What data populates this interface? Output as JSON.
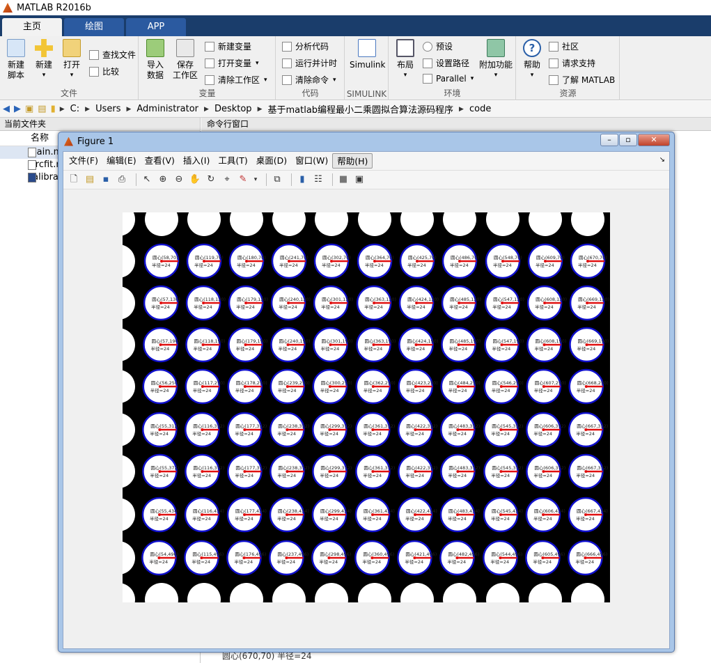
{
  "app": {
    "title": "MATLAB R2016b"
  },
  "tabs": [
    {
      "label": "主页"
    },
    {
      "label": "绘图"
    },
    {
      "label": "APP"
    }
  ],
  "ribbon": {
    "file": {
      "title": "文件",
      "new_script": "新建\n脚本",
      "new": "新建",
      "open": "打开",
      "find_files": "查找文件",
      "compare": "比较"
    },
    "variable": {
      "title": "变量",
      "import": "导入\n数据",
      "save_ws": "保存\n工作区",
      "new_var": "新建变量",
      "open_var": "打开变量",
      "clear_ws": "清除工作区"
    },
    "code": {
      "title": "代码",
      "analyze": "分析代码",
      "run_time": "运行并计时",
      "clear_cmd": "清除命令"
    },
    "simulink": {
      "title": "SIMULINK",
      "simulink": "Simulink"
    },
    "env": {
      "title": "环境",
      "layout": "布局",
      "prefs": "预设",
      "set_path": "设置路径",
      "parallel": "Parallel",
      "addons": "附加功能"
    },
    "res": {
      "title": "资源",
      "help": "帮助",
      "community": "社区",
      "support": "请求支持",
      "learn": "了解 MATLAB"
    }
  },
  "address": {
    "crumbs": [
      "C:",
      "Users",
      "Administrator",
      "Desktop",
      "基于matlab编程最小二乘圆拟合算法源码程序",
      "code"
    ]
  },
  "current_folder": {
    "header": "当前文件夹",
    "name_col": "名称",
    "files": [
      {
        "name": "main.m"
      },
      {
        "name": "circfit.m"
      },
      {
        "name": "calibrat"
      }
    ]
  },
  "command_window": {
    "header": "命令行窗口",
    "last_line": "圆心(670,70) 半径=24"
  },
  "figure": {
    "title": "Figure 1",
    "menus": [
      "文件(F)",
      "编辑(E)",
      "查看(V)",
      "插入(I)",
      "工具(T)",
      "桌面(D)",
      "窗口(W)",
      "帮助(H)"
    ],
    "circle_radius_label": "半径=24",
    "center_prefix": "圆心",
    "col_x": [
      58,
      119,
      180,
      241,
      302,
      364,
      425,
      486,
      548,
      609,
      670
    ],
    "row_x_offset": [
      0,
      -0.9,
      -1.5,
      -2.2,
      -2.7,
      -2.6,
      -3.0,
      -3.6
    ],
    "colors": {
      "circle_fill": "#ffffff",
      "circle_edge": "#1010cc",
      "radius_line": "#e01010",
      "background": "#000000"
    }
  }
}
